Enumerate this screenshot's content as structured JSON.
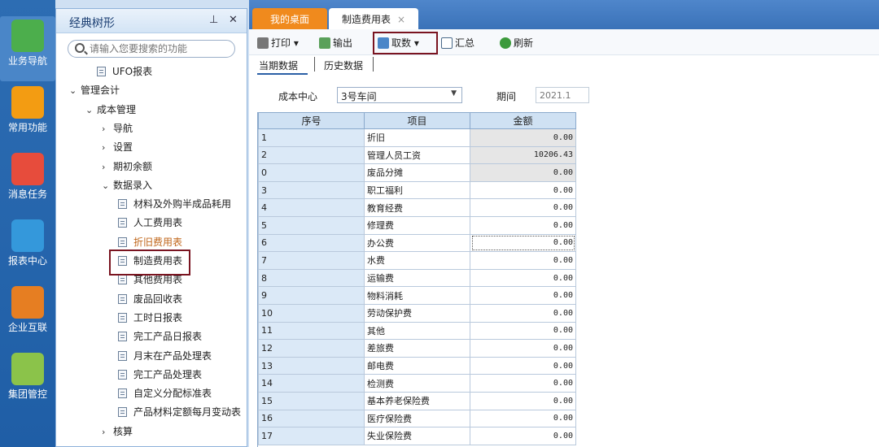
{
  "left_nav": [
    {
      "id": "business",
      "label": "业务导航",
      "color": "#4cae4c"
    },
    {
      "id": "common",
      "label": "常用功能",
      "color": "#f39c12"
    },
    {
      "id": "messages",
      "label": "消息任务",
      "color": "#e74c3c"
    },
    {
      "id": "reports",
      "label": "报表中心",
      "color": "#3498db"
    },
    {
      "id": "enterprise",
      "label": "企业互联",
      "color": "#e67e22"
    },
    {
      "id": "group",
      "label": "集团管控",
      "color": "#8bc34a"
    }
  ],
  "panel": {
    "title": "经典树形",
    "pin": "⊥",
    "close": "✕",
    "search_placeholder": "请输入您要搜索的功能"
  },
  "tree": [
    {
      "label": "UFO报表",
      "type": "leaf"
    },
    {
      "label": "管理会计",
      "type": "open"
    },
    {
      "label": "成本管理",
      "type": "open"
    },
    {
      "label": "导航",
      "type": "closed"
    },
    {
      "label": "设置",
      "type": "closed"
    },
    {
      "label": "期初余额",
      "type": "closed"
    },
    {
      "label": "数据录入",
      "type": "open"
    },
    {
      "label": "材料及外购半成品耗用",
      "type": "leaf"
    },
    {
      "label": "人工费用表",
      "type": "leaf"
    },
    {
      "label": "折旧费用表",
      "type": "leaf",
      "color": "#c0661a"
    },
    {
      "label": "制造费用表",
      "type": "leaf"
    },
    {
      "label": "其他费用表",
      "type": "leaf"
    },
    {
      "label": "废品回收表",
      "type": "leaf"
    },
    {
      "label": "工时日报表",
      "type": "leaf"
    },
    {
      "label": "完工产品日报表",
      "type": "leaf"
    },
    {
      "label": "月末在产品处理表",
      "type": "leaf"
    },
    {
      "label": "完工产品处理表",
      "type": "leaf"
    },
    {
      "label": "自定义分配标准表",
      "type": "leaf"
    },
    {
      "label": "产品材料定额每月变动表",
      "type": "leaf"
    },
    {
      "label": "核算",
      "type": "closed"
    }
  ],
  "tabs": {
    "home": "我的桌面",
    "active": "制造费用表",
    "close": "×"
  },
  "toolbar": {
    "print": "打印",
    "export": "输出",
    "fetch": "取数",
    "summary": "汇总",
    "refresh": "刷新"
  },
  "subtabs": {
    "current": "当期数据",
    "history": "历史数据"
  },
  "form": {
    "cost_center_label": "成本中心",
    "cost_center_value": "3号车间",
    "period_label": "期间",
    "period_value": "2021.1"
  },
  "table": {
    "headers": [
      "序号",
      "项目",
      "金额"
    ],
    "rows": [
      [
        "1",
        "折旧",
        "0.00"
      ],
      [
        "2",
        "管理人员工资",
        "10206.43"
      ],
      [
        "0",
        "废品分摊",
        "0.00"
      ],
      [
        "3",
        "职工福利",
        "0.00"
      ],
      [
        "4",
        "教育经费",
        "0.00"
      ],
      [
        "5",
        "修理费",
        "0.00"
      ],
      [
        "6",
        "办公费",
        "0.00"
      ],
      [
        "7",
        "水费",
        "0.00"
      ],
      [
        "8",
        "运输费",
        "0.00"
      ],
      [
        "9",
        "物料消耗",
        "0.00"
      ],
      [
        "10",
        "劳动保护费",
        "0.00"
      ],
      [
        "11",
        "其他",
        "0.00"
      ],
      [
        "12",
        "差旅费",
        "0.00"
      ],
      [
        "13",
        "邮电费",
        "0.00"
      ],
      [
        "14",
        "检测费",
        "0.00"
      ],
      [
        "15",
        "基本养老保险费",
        "0.00"
      ],
      [
        "16",
        "医疗保险费",
        "0.00"
      ],
      [
        "17",
        "失业保险费",
        "0.00"
      ]
    ]
  }
}
